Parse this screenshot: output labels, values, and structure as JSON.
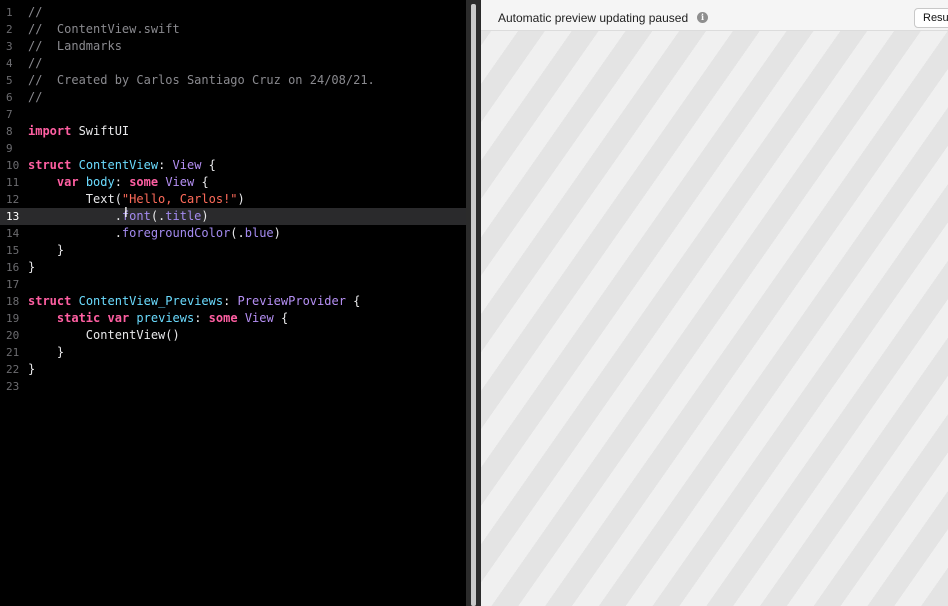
{
  "editor": {
    "current_line": 13,
    "lines": [
      {
        "n": "1",
        "tokens": [
          {
            "t": "//",
            "k": "comment"
          }
        ]
      },
      {
        "n": "2",
        "tokens": [
          {
            "t": "//  ContentView.swift",
            "k": "comment"
          }
        ]
      },
      {
        "n": "3",
        "tokens": [
          {
            "t": "//  Landmarks",
            "k": "comment"
          }
        ]
      },
      {
        "n": "4",
        "tokens": [
          {
            "t": "//",
            "k": "comment"
          }
        ]
      },
      {
        "n": "5",
        "tokens": [
          {
            "t": "//  Created by Carlos Santiago Cruz on 24/08/21.",
            "k": "comment"
          }
        ]
      },
      {
        "n": "6",
        "tokens": [
          {
            "t": "//",
            "k": "comment"
          }
        ]
      },
      {
        "n": "7",
        "tokens": []
      },
      {
        "n": "8",
        "tokens": [
          {
            "t": "import",
            "k": "kw"
          },
          {
            "t": " SwiftUI",
            "k": "plain"
          }
        ]
      },
      {
        "n": "9",
        "tokens": []
      },
      {
        "n": "10",
        "tokens": [
          {
            "t": "struct",
            "k": "kw"
          },
          {
            "t": " ",
            "k": "plain"
          },
          {
            "t": "ContentView",
            "k": "decl"
          },
          {
            "t": ": ",
            "k": "plain"
          },
          {
            "t": "View",
            "k": "type"
          },
          {
            "t": " {",
            "k": "plain"
          }
        ]
      },
      {
        "n": "11",
        "tokens": [
          {
            "t": "    ",
            "k": "plain"
          },
          {
            "t": "var",
            "k": "kw"
          },
          {
            "t": " ",
            "k": "plain"
          },
          {
            "t": "body",
            "k": "decl"
          },
          {
            "t": ": ",
            "k": "plain"
          },
          {
            "t": "some",
            "k": "kw"
          },
          {
            "t": " ",
            "k": "plain"
          },
          {
            "t": "View",
            "k": "type"
          },
          {
            "t": " {",
            "k": "plain"
          }
        ]
      },
      {
        "n": "12",
        "tokens": [
          {
            "t": "        Text(",
            "k": "plain"
          },
          {
            "t": "\"Hello, Carlos!\"",
            "k": "str"
          },
          {
            "t": ")",
            "k": "plain"
          }
        ]
      },
      {
        "n": "13",
        "tokens": [
          {
            "t": "            .",
            "k": "plain"
          },
          {
            "t": "font",
            "k": "mem"
          },
          {
            "t": "(.",
            "k": "plain"
          },
          {
            "t": "title",
            "k": "mem"
          },
          {
            "t": ")",
            "k": "plain"
          }
        ]
      },
      {
        "n": "14",
        "tokens": [
          {
            "t": "            .",
            "k": "plain"
          },
          {
            "t": "foregroundColor",
            "k": "mem"
          },
          {
            "t": "(.",
            "k": "plain"
          },
          {
            "t": "blue",
            "k": "mem"
          },
          {
            "t": ")",
            "k": "plain"
          }
        ]
      },
      {
        "n": "15",
        "tokens": [
          {
            "t": "    }",
            "k": "plain"
          }
        ]
      },
      {
        "n": "16",
        "tokens": [
          {
            "t": "}",
            "k": "plain"
          }
        ]
      },
      {
        "n": "17",
        "tokens": []
      },
      {
        "n": "18",
        "tokens": [
          {
            "t": "struct",
            "k": "kw"
          },
          {
            "t": " ",
            "k": "plain"
          },
          {
            "t": "ContentView_Previews",
            "k": "decl"
          },
          {
            "t": ": ",
            "k": "plain"
          },
          {
            "t": "PreviewProvider",
            "k": "type"
          },
          {
            "t": " {",
            "k": "plain"
          }
        ]
      },
      {
        "n": "19",
        "tokens": [
          {
            "t": "    ",
            "k": "plain"
          },
          {
            "t": "static",
            "k": "kw"
          },
          {
            "t": " ",
            "k": "plain"
          },
          {
            "t": "var",
            "k": "kw"
          },
          {
            "t": " ",
            "k": "plain"
          },
          {
            "t": "previews",
            "k": "decl"
          },
          {
            "t": ": ",
            "k": "plain"
          },
          {
            "t": "some",
            "k": "kw"
          },
          {
            "t": " ",
            "k": "plain"
          },
          {
            "t": "View",
            "k": "type"
          },
          {
            "t": " {",
            "k": "plain"
          }
        ]
      },
      {
        "n": "20",
        "tokens": [
          {
            "t": "        ContentView()",
            "k": "plain"
          }
        ]
      },
      {
        "n": "21",
        "tokens": [
          {
            "t": "    }",
            "k": "plain"
          }
        ]
      },
      {
        "n": "22",
        "tokens": [
          {
            "t": "}",
            "k": "plain"
          }
        ]
      },
      {
        "n": "23",
        "tokens": []
      }
    ],
    "text_cursor_icon": "i-beam-cursor-icon"
  },
  "preview": {
    "status": "Automatic preview updating paused",
    "info_icon": "info-icon",
    "resume_label": "Resume"
  },
  "colors": {
    "editor_bg": "#000000",
    "comment": "#8a8a8f",
    "keyword": "#ff5fa2",
    "type": "#b690f5",
    "declaration": "#6bdcff",
    "string": "#ff6b5a",
    "member": "#a48bf0",
    "preview_bg": "#e9e9e9"
  }
}
